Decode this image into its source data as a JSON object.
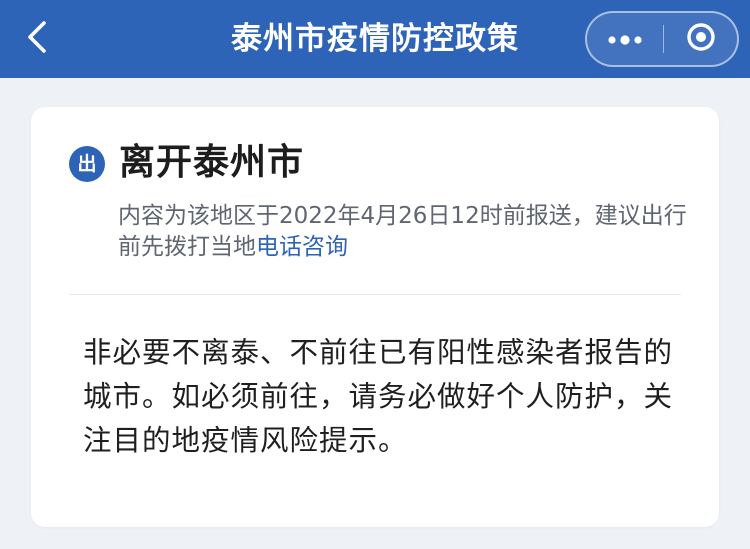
{
  "header": {
    "title": "泰州市疫情防控政策",
    "background_color": "#2e64b8",
    "back_icon": "chevron-left-icon",
    "more_icon": "more-dots-icon",
    "close_icon": "target-close-icon"
  },
  "card": {
    "badge": "出",
    "title": "离开泰州市",
    "description": "内容为该地区于2022年4月26日12时前报送，建议出行前先拨打当地",
    "link_label": "电话咨询",
    "body": "非必要不离泰、不前往已有阳性感染者报告的城市。如必须前往，请务必做好个人防护，关注目的地疫情风险提示。",
    "accent_color": "#2e64b8"
  }
}
